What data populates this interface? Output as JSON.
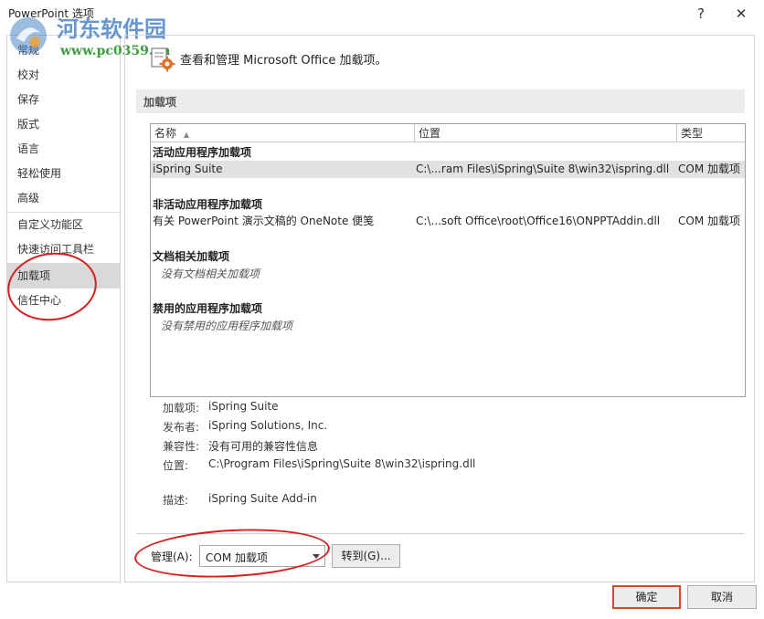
{
  "window": {
    "title": "PowerPoint 选项",
    "help_label": "?",
    "close_label": "✕"
  },
  "watermark": {
    "name": "河东软件园",
    "url": "www.pc0359.cn"
  },
  "sidebar": {
    "items": [
      {
        "label": "常规"
      },
      {
        "label": "校对"
      },
      {
        "label": "保存"
      },
      {
        "label": "版式"
      },
      {
        "label": "语言"
      },
      {
        "label": "轻松使用"
      },
      {
        "label": "高级"
      },
      {
        "label": "自定义功能区"
      },
      {
        "label": "快速访问工具栏"
      },
      {
        "label": "加载项"
      },
      {
        "label": "信任中心"
      }
    ],
    "selected": "加载项"
  },
  "header": {
    "text": "查看和管理 Microsoft Office 加载项。"
  },
  "section": {
    "title": "加载项"
  },
  "table": {
    "columns": [
      "名称",
      "位置",
      "类型"
    ],
    "groups": {
      "active": "活动应用程序加载项",
      "inactive": "非活动应用程序加载项",
      "document": "文档相关加载项",
      "disabled": "禁用的应用程序加载项"
    },
    "rows": {
      "ispring": {
        "name": "iSpring Suite",
        "location": "C:\\...ram Files\\iSpring\\Suite 8\\win32\\ispring.dll",
        "type": "COM 加载项"
      },
      "onenote": {
        "name": "有关 PowerPoint 演示文稿的 OneNote 便笺",
        "location": "C:\\...soft Office\\root\\Office16\\ONPPTAddin.dll",
        "type": "COM 加载项"
      }
    },
    "empty": {
      "document": "没有文档相关加载项",
      "disabled": "没有禁用的应用程序加载项"
    }
  },
  "details": {
    "addin_label": "加载项:",
    "addin_value": "iSpring Suite",
    "publisher_label": "发布者:",
    "publisher_value": "iSpring Solutions, Inc.",
    "compat_label": "兼容性:",
    "compat_value": "没有可用的兼容性信息",
    "location_label": "位置:",
    "location_value": "C:\\Program Files\\iSpring\\Suite 8\\win32\\ispring.dll",
    "desc_label": "描述:",
    "desc_value": "iSpring Suite Add-in"
  },
  "manage": {
    "label": "管理(A):",
    "selected": "COM 加载项",
    "go_label": "转到(G)..."
  },
  "footer": {
    "ok_label": "确定",
    "cancel_label": "取消"
  },
  "colors": {
    "annotation_red": "#d41f1f",
    "default_button_border": "#d8472d",
    "selection_gray": "#d9d9d9"
  }
}
